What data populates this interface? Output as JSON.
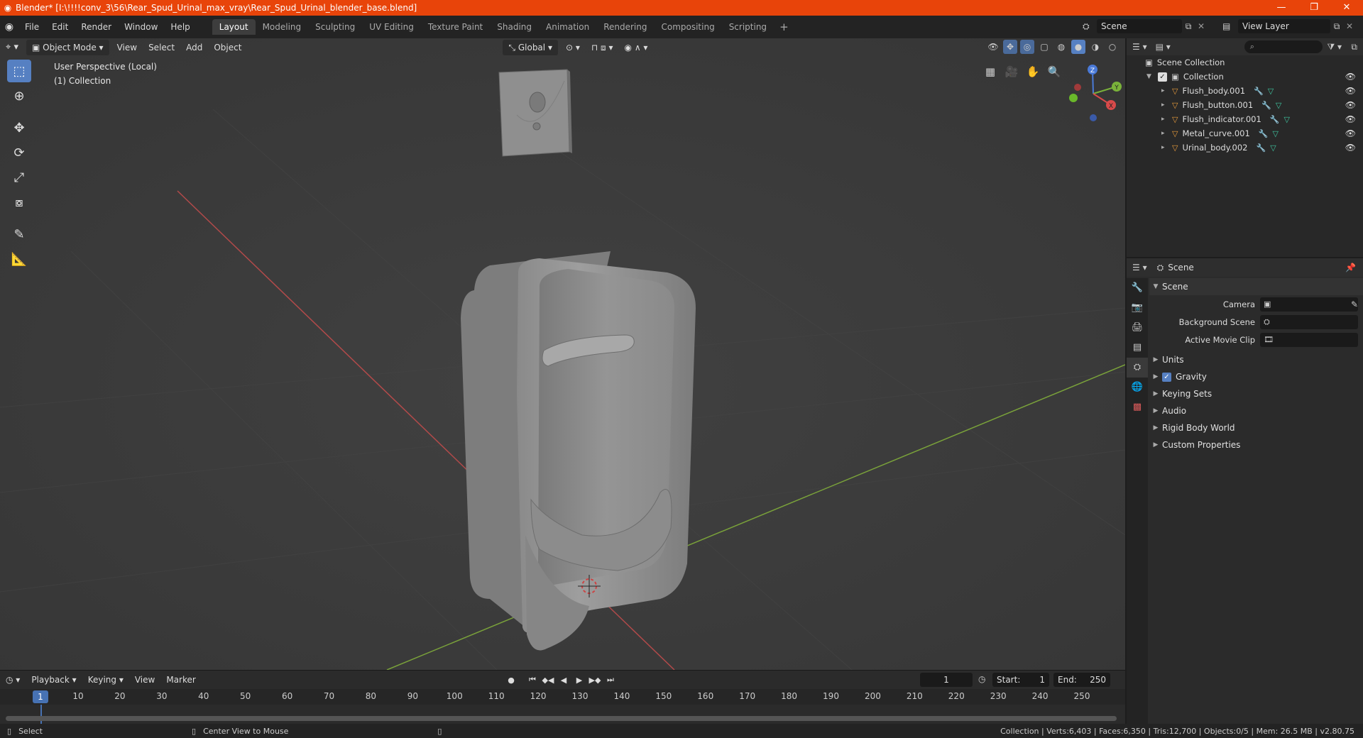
{
  "window": {
    "title": "Blender* [I:\\!!!!conv_3\\56\\Rear_Spud_Urinal_max_vray\\Rear_Spud_Urinal_blender_base.blend]"
  },
  "menu": [
    "File",
    "Edit",
    "Render",
    "Window",
    "Help"
  ],
  "workspaces": [
    "Layout",
    "Modeling",
    "Sculpting",
    "UV Editing",
    "Texture Paint",
    "Shading",
    "Animation",
    "Rendering",
    "Compositing",
    "Scripting"
  ],
  "active_workspace": "Layout",
  "scene_name": "Scene",
  "view_layer": "View Layer",
  "viewport": {
    "mode": "Object Mode",
    "menus": [
      "View",
      "Select",
      "Add",
      "Object"
    ],
    "orientation": "Global",
    "info_line1": "User Perspective (Local)",
    "info_line2": "(1) Collection"
  },
  "timeline": {
    "menus": [
      "Playback",
      "Keying",
      "View",
      "Marker"
    ],
    "current_frame": "1",
    "start_label": "Start:",
    "start": "1",
    "end_label": "End:",
    "end": "250",
    "ticks": [
      "1",
      "10",
      "20",
      "30",
      "40",
      "50",
      "60",
      "70",
      "80",
      "90",
      "100",
      "110",
      "120",
      "130",
      "140",
      "150",
      "160",
      "170",
      "180",
      "190",
      "200",
      "210",
      "220",
      "230",
      "240",
      "250"
    ]
  },
  "outliner": {
    "root": "Scene Collection",
    "collection": "Collection",
    "objects": [
      "Flush_body.001",
      "Flush_button.001",
      "Flush_indicator.001",
      "Metal_curve.001",
      "Urinal_body.002"
    ]
  },
  "properties": {
    "header": "Scene",
    "panel": "Scene",
    "camera_label": "Camera",
    "background_label": "Background Scene",
    "movieclip_label": "Active Movie Clip",
    "sections": [
      "Units",
      "Gravity",
      "Keying Sets",
      "Audio",
      "Rigid Body World",
      "Custom Properties"
    ]
  },
  "status": {
    "select": "Select",
    "center": "Center View to Mouse",
    "stats": "Collection | Verts:6,403 | Faces:6,350 | Tris:12,700 | Objects:0/5 | Mem: 26.5 MB | v2.80.75"
  }
}
